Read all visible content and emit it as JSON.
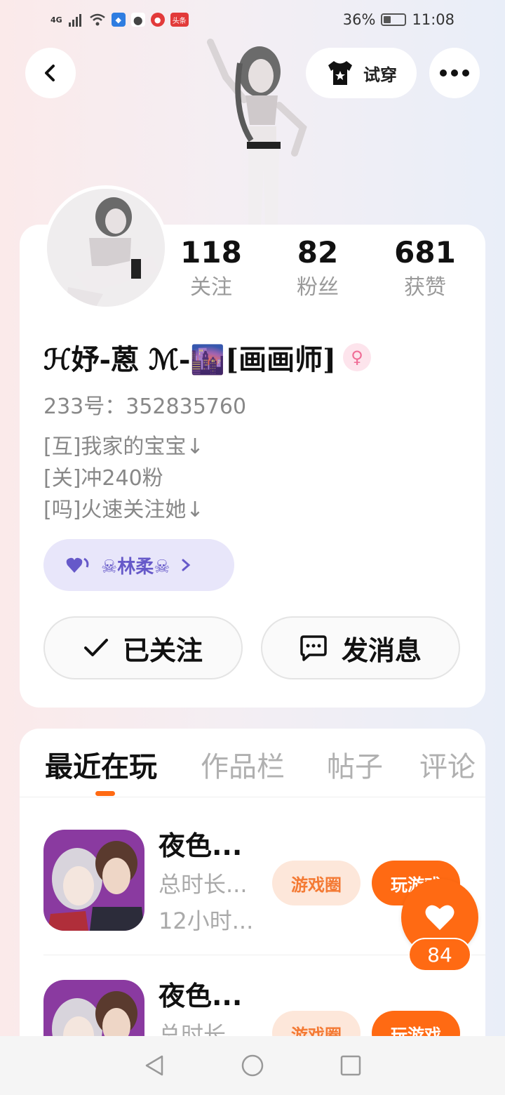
{
  "status_bar": {
    "network": "4G",
    "battery_pct": "36%",
    "time": "11:08",
    "app_badge": "头条"
  },
  "header": {
    "tryon_label": "试穿"
  },
  "profile": {
    "stats": [
      {
        "num": "118",
        "label": "关注"
      },
      {
        "num": "82",
        "label": "粉丝"
      },
      {
        "num": "681",
        "label": "获赞"
      }
    ],
    "name": "ℋ妤-蒽 ℳ-🌆[画画师]",
    "gender_symbol": "♀",
    "uid": "233号：352835760",
    "bio": [
      "[互]我家的宝宝↓",
      "[关]冲240粉",
      "[吗]火速关注她↓"
    ],
    "fan_chip_label": "☠林柔☠",
    "followed_label": "已关注",
    "message_label": "发消息"
  },
  "tabs": [
    {
      "label": "最近在玩",
      "active": true
    },
    {
      "label": "作品栏",
      "active": false
    },
    {
      "label": "帖子",
      "active": false
    },
    {
      "label": "评论",
      "active": false
    }
  ],
  "games": [
    {
      "title": "夜色...",
      "meta1": "总时长...",
      "meta2": "12小时...",
      "circle_label": "游戏圈",
      "play_label": "玩游戏"
    },
    {
      "title": "夜色...",
      "meta1": "总时长...",
      "meta2": "",
      "circle_label": "游戏圈",
      "play_label": "玩游戏"
    }
  ],
  "like": {
    "count": "84"
  },
  "colors": {
    "accent": "#ff6a13",
    "chip_bg": "#e8e6fa",
    "chip_text": "#6659c9"
  }
}
